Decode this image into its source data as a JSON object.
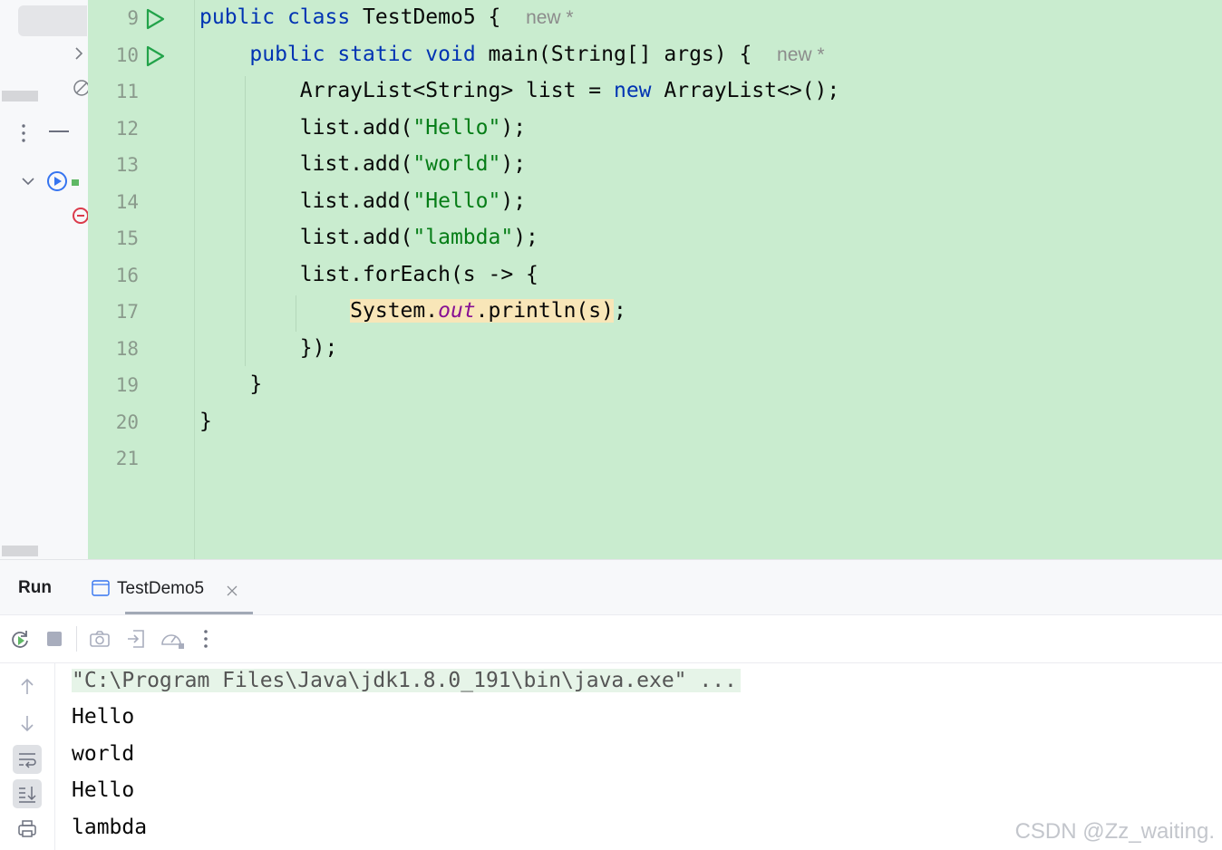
{
  "editor": {
    "lines": [
      {
        "num": "9",
        "tokens": [
          {
            "t": "public",
            "c": "kw"
          },
          {
            "t": " "
          },
          {
            "t": "class",
            "c": "kw"
          },
          {
            "t": " TestDemo5 {  "
          },
          {
            "t": "new *",
            "c": "hint"
          }
        ]
      },
      {
        "num": "10",
        "tokens": [
          {
            "t": "    "
          },
          {
            "t": "public",
            "c": "kw"
          },
          {
            "t": " "
          },
          {
            "t": "static",
            "c": "kw"
          },
          {
            "t": " "
          },
          {
            "t": "void",
            "c": "kw"
          },
          {
            "t": " main(String[] args) {  "
          },
          {
            "t": "new *",
            "c": "hint"
          }
        ]
      },
      {
        "num": "11",
        "tokens": [
          {
            "t": "        ArrayList<String> list = "
          },
          {
            "t": "new",
            "c": "kw"
          },
          {
            "t": " ArrayList<>();"
          }
        ]
      },
      {
        "num": "12",
        "tokens": [
          {
            "t": "        list.add("
          },
          {
            "t": "\"Hello\"",
            "c": "str"
          },
          {
            "t": ");"
          }
        ]
      },
      {
        "num": "13",
        "tokens": [
          {
            "t": "        list.add("
          },
          {
            "t": "\"world\"",
            "c": "str"
          },
          {
            "t": ");"
          }
        ]
      },
      {
        "num": "14",
        "tokens": [
          {
            "t": "        list.add("
          },
          {
            "t": "\"Hello\"",
            "c": "str"
          },
          {
            "t": ");"
          }
        ]
      },
      {
        "num": "15",
        "tokens": [
          {
            "t": "        list.add("
          },
          {
            "t": "\"lambda\"",
            "c": "str"
          },
          {
            "t": ");"
          }
        ]
      },
      {
        "num": "16",
        "tokens": [
          {
            "t": "        list.forEach(s -> {"
          }
        ]
      },
      {
        "num": "17",
        "tokens": [
          {
            "t": "            "
          },
          {
            "t": "System.",
            "c": "hl"
          },
          {
            "t": "out",
            "c": "fld hl"
          },
          {
            "t": ".println(s)",
            "c": "hl"
          },
          {
            "t": ";"
          }
        ]
      },
      {
        "num": "18",
        "tokens": [
          {
            "t": "        });"
          }
        ]
      },
      {
        "num": "19",
        "tokens": [
          {
            "t": "    }"
          }
        ]
      },
      {
        "num": "20",
        "tokens": [
          {
            "t": "}"
          }
        ]
      },
      {
        "num": "21",
        "tokens": []
      }
    ],
    "run_markers": [
      "9",
      "10"
    ]
  },
  "run_window": {
    "title": "Run",
    "tab_label": "TestDemo5",
    "toolbar_icons": [
      "rerun-icon",
      "stop-icon",
      "camera-icon",
      "exit-icon",
      "profiler-icon",
      "more-icon"
    ],
    "side_icons": [
      "scroll-up-icon",
      "scroll-down-icon",
      "soft-wrap-icon",
      "scroll-to-end-icon",
      "print-icon"
    ]
  },
  "console": {
    "command": "\"C:\\Program Files\\Java\\jdk1.8.0_191\\bin\\java.exe\" ...",
    "output": [
      "Hello",
      "world",
      "Hello",
      "lambda"
    ]
  },
  "watermark": "CSDN @Zz_waiting.",
  "colors": {
    "editor_bg": "#c9eccf",
    "keyword": "#0033b3",
    "string": "#067d17",
    "field": "#871094",
    "highlight": "#f8e6b8"
  }
}
